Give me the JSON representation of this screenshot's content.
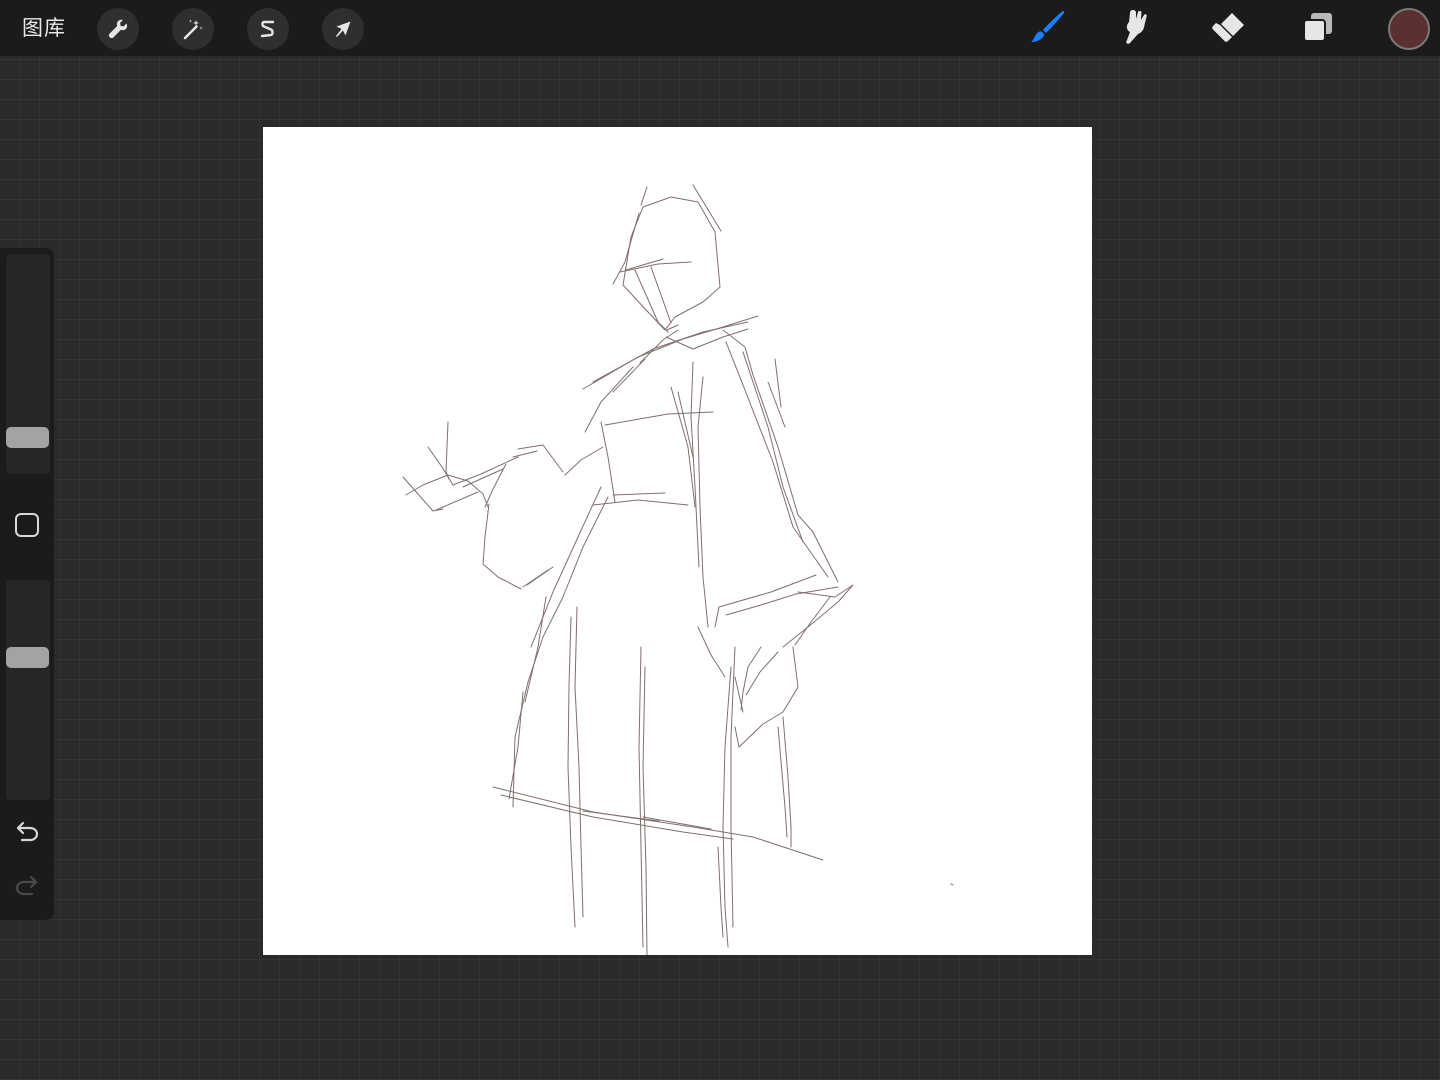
{
  "toolbar": {
    "gallery_label": "图库",
    "left_tools": [
      {
        "icon": "wrench-icon",
        "name": "actions"
      },
      {
        "icon": "magic-wand-icon",
        "name": "adjustments"
      },
      {
        "icon": "selection-s-icon",
        "name": "selection"
      },
      {
        "icon": "arrow-cursor-icon",
        "name": "transform"
      }
    ],
    "right_tools": [
      {
        "icon": "brush-icon",
        "name": "brush",
        "active": true
      },
      {
        "icon": "smudge-icon",
        "name": "smudge",
        "active": false
      },
      {
        "icon": "eraser-icon",
        "name": "eraser",
        "active": false
      },
      {
        "icon": "layers-icon",
        "name": "layers",
        "active": false
      }
    ],
    "active_tool_color": "#1a7fff",
    "inactive_tool_color": "#e6e6e6",
    "current_color": "#5a3030"
  },
  "sidebar": {
    "brush_size_icon": "slider-thumb",
    "modify_icon": "square-icon",
    "undo_icon": "undo-icon",
    "redo_icon": "redo-icon",
    "redo_enabled": false
  },
  "canvas": {
    "background": "#ffffff",
    "stroke_color": "#6b5555"
  }
}
